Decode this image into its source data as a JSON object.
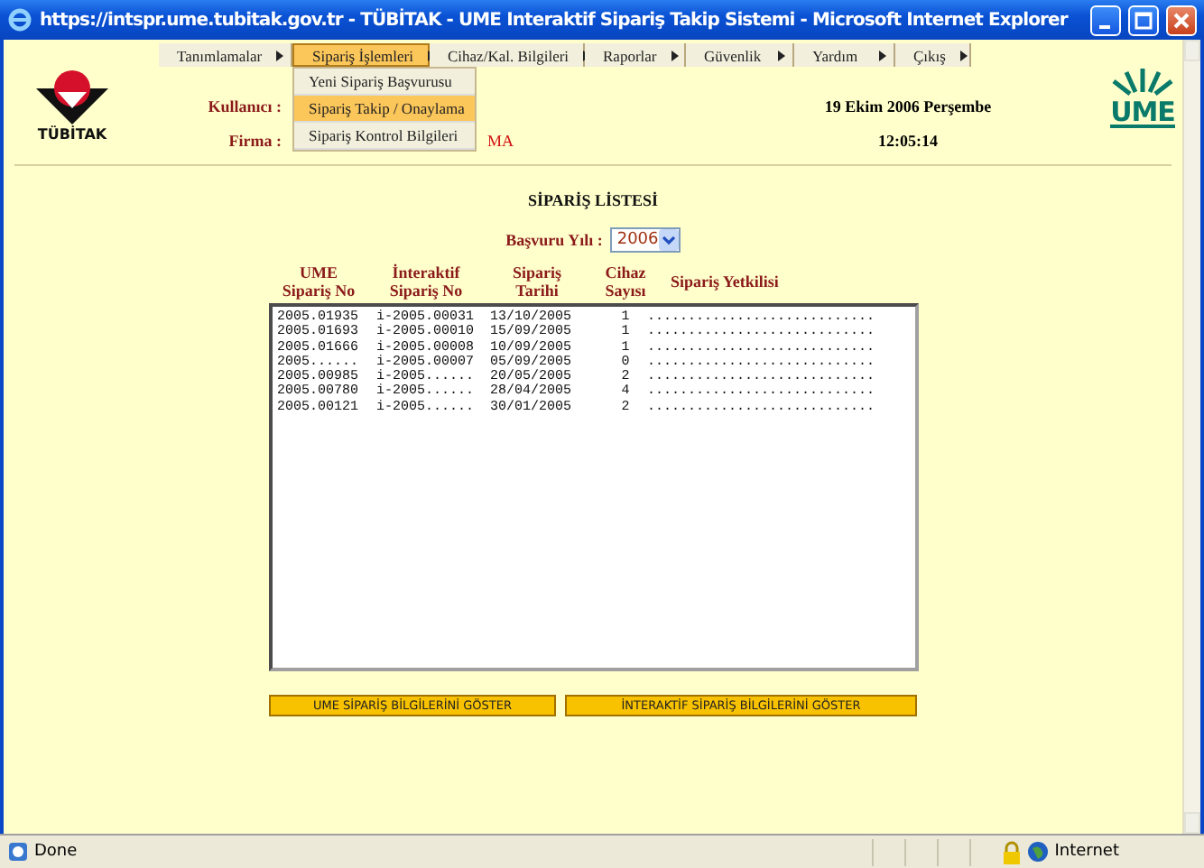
{
  "window": {
    "title": "https://intspr.ume.tubitak.gov.tr - TÜBİTAK - UME Interaktif Sipariş Takip Sistemi - Microsoft Internet Explorer"
  },
  "menu": [
    {
      "label": "Tanımlamalar",
      "open": false
    },
    {
      "label": "Sipariş İşlemleri",
      "open": true
    },
    {
      "label": "Cihaz/Kal. Bilgileri",
      "open": false
    },
    {
      "label": "Raporlar",
      "open": false
    },
    {
      "label": "Güvenlik",
      "open": false
    },
    {
      "label": "Yardım",
      "open": false
    },
    {
      "label": "Çıkış",
      "open": false
    }
  ],
  "submenu": [
    {
      "label": "Yeni Sipariş Başvurusu",
      "selected": false
    },
    {
      "label": "Sipariş Takip / Onaylama",
      "selected": true
    },
    {
      "label": "Sipariş Kontrol Bilgileri",
      "selected": false
    }
  ],
  "header": {
    "logo_text": "TÜBİTAK",
    "user_label": "Kullanıcı :",
    "firm_label": "Firma :",
    "firm_value": "MA",
    "date": "19 Ekim 2006 Perşembe",
    "time": "12:05:14",
    "ume_logo": "UME"
  },
  "list_title": "SİPARİŞ LİSTESİ",
  "year": {
    "label": "Başvuru Yılı :",
    "value": "2006"
  },
  "table": {
    "columns": [
      "UME\nSipariş No",
      "İnteraktif\nSipariş No",
      "Sipariş\nTarihi",
      "Cihaz\nSayısı",
      "Sipariş Yetkilisi"
    ],
    "rows": [
      [
        "2005.01935",
        "i-2005.00031",
        "13/10/2005",
        "1",
        "............................"
      ],
      [
        "2005.01693",
        "i-2005.00010",
        "15/09/2005",
        "1",
        "............................"
      ],
      [
        "2005.01666",
        "i-2005.00008",
        "10/09/2005",
        "1",
        "............................"
      ],
      [
        "2005......",
        "i-2005.00007",
        "05/09/2005",
        "0",
        "............................"
      ],
      [
        "2005.00985",
        "i-2005......",
        "20/05/2005",
        "2",
        "............................"
      ],
      [
        "2005.00780",
        "i-2005......",
        "28/04/2005",
        "4",
        "............................"
      ],
      [
        "2005.00121",
        "i-2005......",
        "30/01/2005",
        "2",
        "............................"
      ]
    ]
  },
  "buttons": [
    "UME SİPARİŞ BİLGİLERİNİ GÖSTER",
    "İNTERAKTİF SİPARİŞ BİLGİLERİNİ GÖSTER"
  ],
  "status_bar": {
    "text": "Done",
    "zone": "Internet"
  }
}
